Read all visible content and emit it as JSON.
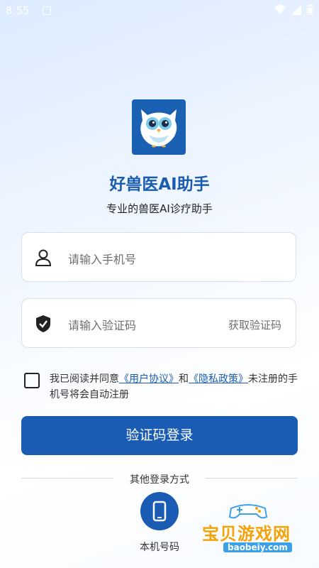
{
  "status_bar": {
    "time": "8:55"
  },
  "app": {
    "title": "好兽医AI助手",
    "subtitle": "专业的兽医AI诊疗助手"
  },
  "phone_field": {
    "placeholder": "请输入手机号",
    "icon": "user-icon"
  },
  "code_field": {
    "placeholder": "请输入验证码",
    "icon": "shield-check-icon",
    "get_code_label": "获取验证码"
  },
  "agreement": {
    "checked": false,
    "prefix": "我已阅读并同意",
    "user_agreement": "《用户协议》",
    "and": "和",
    "privacy_policy": "《隐私政策》",
    "suffix": "未注册的手机号将会自动注册"
  },
  "login_button": {
    "label": "验证码登录"
  },
  "other_login": {
    "label": "其他登录方式",
    "options": [
      {
        "label": "本机号码",
        "icon": "phone-icon"
      }
    ]
  },
  "watermark": {
    "text": "宝贝游戏网",
    "url": "baobeiy.com"
  },
  "colors": {
    "primary": "#1a5cb3",
    "link": "#1a5cb0"
  }
}
